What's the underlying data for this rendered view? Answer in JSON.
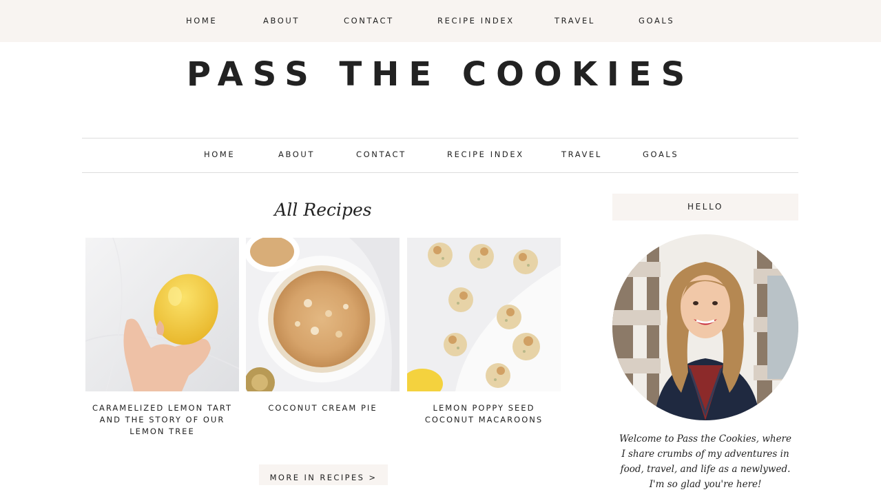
{
  "top_nav": {
    "items": [
      "HOME",
      "ABOUT",
      "CONTACT",
      "RECIPE INDEX",
      "TRAVEL",
      "GOALS"
    ]
  },
  "site_title": "PASS THE COOKIES",
  "main_nav": {
    "items": [
      "HOME",
      "ABOUT",
      "CONTACT",
      "RECIPE INDEX",
      "TRAVEL",
      "GOALS"
    ]
  },
  "section_heading": "All Recipes",
  "recipes": [
    {
      "title": "CARAMELIZED LEMON TART AND THE STORY OF OUR LEMON TREE"
    },
    {
      "title": "COCONUT CREAM PIE"
    },
    {
      "title": "LEMON POPPY SEED COCONUT MACAROONS"
    }
  ],
  "more_button": "MORE IN RECIPES >",
  "sidebar": {
    "heading": "HELLO",
    "welcome": "Welcome to Pass the Cookies, where I share crumbs of my adventures in food, travel, and life as a newlywed. I'm so glad you're here!"
  },
  "colors": {
    "accent_bg": "#f8f4f1",
    "text": "#222222",
    "rule": "#dddddd"
  }
}
